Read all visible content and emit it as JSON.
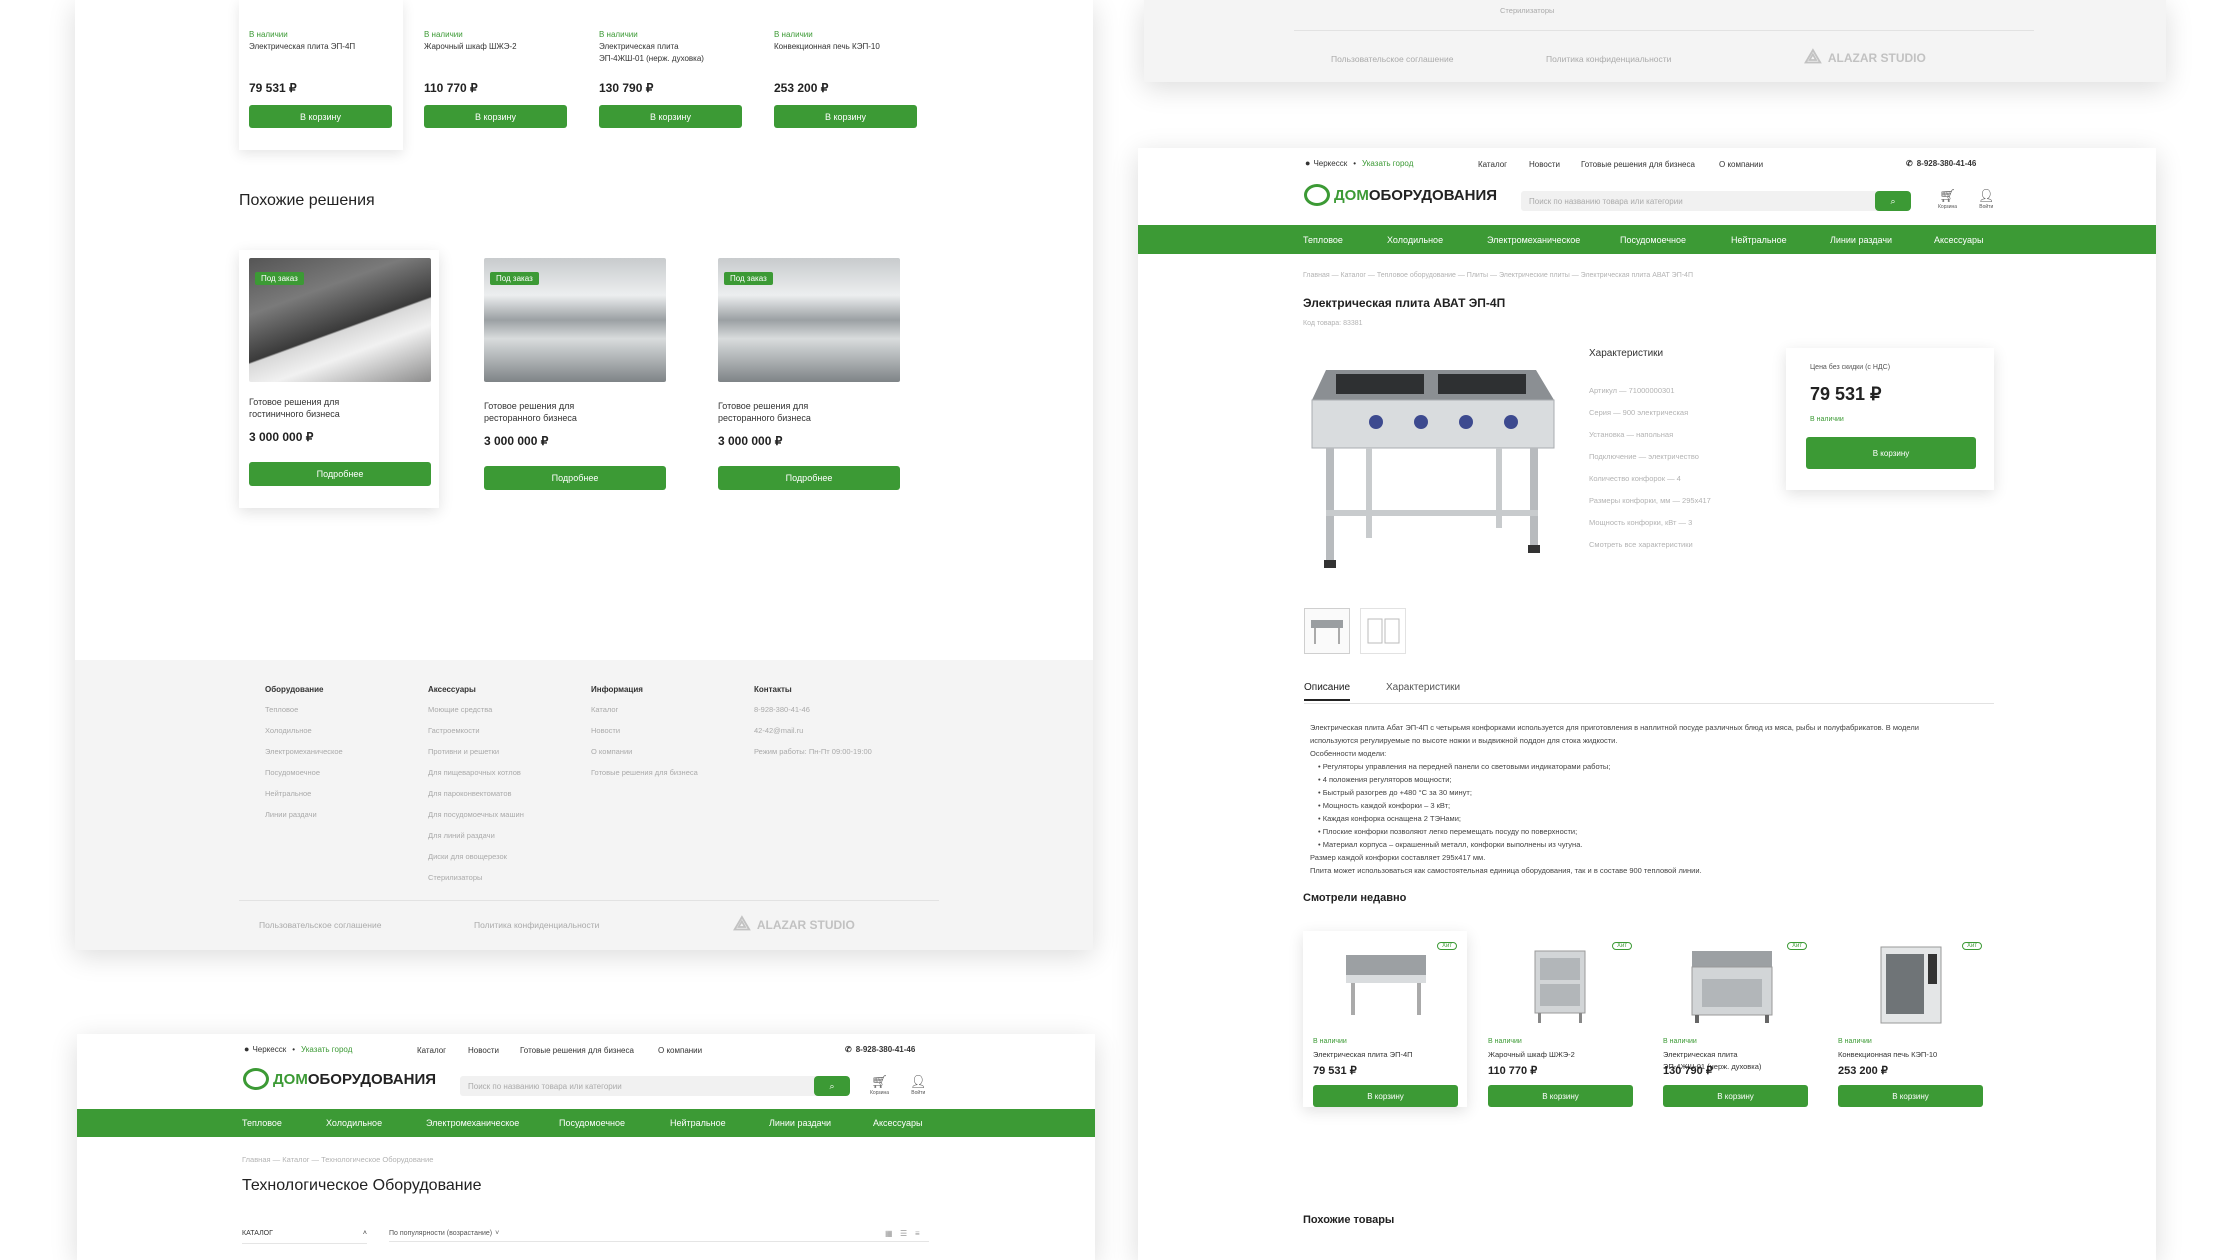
{
  "colors": {
    "accent": "#3c9a35",
    "text": "#222222",
    "muted": "#b3b3b3",
    "footer_bg": "#f4f4f4"
  },
  "panel1": {
    "products": [
      {
        "stock": "В наличии",
        "name": "Электрическая плита ЭП-4П",
        "price": "79 531 ₽",
        "btn": "В корзину"
      },
      {
        "stock": "В наличии",
        "name": "Жарочный шкаф ШЖЭ-2",
        "price": "110 770 ₽",
        "btn": "В корзину"
      },
      {
        "stock": "В наличии",
        "name": "Электрическая плита ЭП-4ЖШ-01 (нерж. духовка)",
        "price": "130 790 ₽",
        "btn": "В корзину"
      },
      {
        "stock": "В наличии",
        "name": "Конвекционная печь КЭП-10",
        "price": "253 200 ₽",
        "btn": "В корзину"
      }
    ],
    "similar_title": "Похожие решения",
    "solutions": [
      {
        "badge": "Под заказ",
        "name": "Готовое решения для гостиничного бизнеса",
        "price": "3 000 000 ₽",
        "btn": "Подробнее"
      },
      {
        "badge": "Под заказ",
        "name": "Готовое решения для ресторанного бизнеса",
        "price": "3 000 000 ₽",
        "btn": "Подробнее"
      },
      {
        "badge": "Под заказ",
        "name": "Готовое решения для ресторанного бизнеса",
        "price": "3 000 000 ₽",
        "btn": "Подробнее"
      }
    ],
    "footer": {
      "cols": [
        {
          "title": "Оборудование",
          "items": [
            "Тепловое",
            "Холодильное",
            "Электромеханическое",
            "Посудомоечное",
            "Нейтральное",
            "Линии раздачи"
          ]
        },
        {
          "title": "Аксессуары",
          "items": [
            "Моющие средства",
            "Гастроемкости",
            "Противни и решетки",
            "Для пищеварочных котлов",
            "Для пароконвектоматов",
            "Для посудомоечных машин",
            "Для линий раздачи",
            "Диски для овощерезок",
            "Стерилизаторы"
          ]
        },
        {
          "title": "Информация",
          "items": [
            "Каталог",
            "Новости",
            "О компании",
            "Готовые решения для бизнеса"
          ]
        },
        {
          "title": "Контакты",
          "items": [
            "8-928-380-41-46",
            "42-42@mail.ru",
            "Режим работы: Пн-Пт 09:00-19:00"
          ]
        }
      ],
      "agreement": "Пользовательское соглашение",
      "privacy": "Политика конфиденциальности",
      "studio": "ALAZAR STUDIO"
    }
  },
  "panel2": {
    "sterilizers": "Стерилизаторы",
    "agreement": "Пользовательское соглашение",
    "privacy": "Политика конфиденциальности",
    "studio": "ALAZAR STUDIO"
  },
  "header": {
    "city": "Черкесск",
    "choose_city": "Указать город",
    "links": [
      "Каталог",
      "Новости",
      "Готовые решения для бизнеса",
      "О компании"
    ],
    "phone": "8-928-380-41-46",
    "logo_a": "ДОМ",
    "logo_b": "ОБОРУДОВАНИЯ",
    "search_placeholder": "Поиск по названию товара или категории",
    "cart": "Корзина",
    "login": "Войти",
    "nav": [
      "Тепловое",
      "Холодильное",
      "Электромеханическое",
      "Посудомоечное",
      "Нейтральное",
      "Линии раздачи",
      "Аксессуары"
    ]
  },
  "panel3": {
    "breadcrumb": "Главная — Каталог — Технологическое Оборудование",
    "title": "Технологическое Оборудование",
    "catalog": "КАТАЛОГ",
    "sort": "По популярности (возрастание)"
  },
  "panel4": {
    "breadcrumb": "Главная — Каталог — Тепловое оборудование — Плиты — Электрические плиты — Электрическая плита АВАТ ЭП-4П",
    "title": "Электрическая плита АВАТ ЭП-4П",
    "code": "Код товара: 83381",
    "specs_title": "Характеристики",
    "specs": [
      "Артикул — 71000000301",
      "Серия — 900 электрическая",
      "Установка — напольная",
      "Подключение — электричество",
      "Количество конфорок — 4",
      "Размеры конфорки, мм — 295х417",
      "Мощность конфорки, кВт — 3",
      "Смотреть все характеристики"
    ],
    "price_label": "Цена без скидки (с НДС)",
    "price": "79 531 ₽",
    "stock": "В наличии",
    "cart_btn": "В корзину",
    "tabs": [
      "Описание",
      "Характеристики"
    ],
    "description": [
      "Электрическая плита Абат ЭП-4П с четырьмя конфорками используется для приготовления в наплитной посуде различных блюд из мяса, рыбы и полуфабрикатов. В модели",
      "используются регулируемые по высоте ножки и выдвижной поддон для стока жидкости.",
      "Особенности модели:",
      "•  Регуляторы управления на передней панели со световыми индикаторами работы;",
      "•  4 положения регуляторов мощности;",
      "•  Быстрый разогрев до +480 °С за 30 минут;",
      "•  Мощность каждой конфорки – 3 кВт;",
      "•  Каждая конфорка оснащена 2 ТЭНами;",
      "•  Плоские конфорки позволяют легко перемещать посуду по поверхности;",
      "•  Материал корпуса – окрашенный металл, конфорки выполнены из чугуна.",
      "Размер каждой конфорки составляет 295х417 мм.",
      "Плита может использоваться как самостоятельная единица оборудования, так и в составе 900 тепловой линии."
    ],
    "recent_title": "Смотрели недавно",
    "hit": "Хит",
    "recent": [
      {
        "stock": "В наличии",
        "name": "Электрическая плита ЭП-4П",
        "price": "79 531 ₽",
        "btn": "В корзину"
      },
      {
        "stock": "В наличии",
        "name": "Жарочный шкаф ШЖЭ-2",
        "price": "110 770 ₽",
        "btn": "В корзину"
      },
      {
        "stock": "В наличии",
        "name": "Электрическая плита ЭП-4ЖШ-01 (нерж. духовка)",
        "price": "130 790 ₽",
        "btn": "В корзину"
      },
      {
        "stock": "В наличии",
        "name": "Конвекционная печь КЭП-10",
        "price": "253 200 ₽",
        "btn": "В корзину"
      }
    ],
    "similar_title": "Похожие товары"
  }
}
